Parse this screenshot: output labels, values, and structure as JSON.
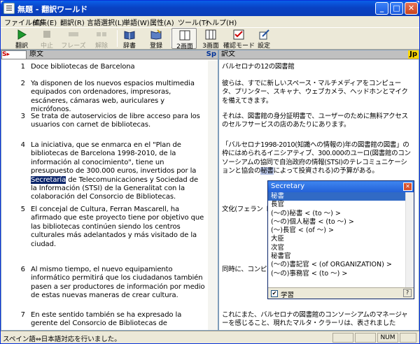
{
  "window": {
    "title": "無題 - 翻訳ワールド",
    "minimize": "_",
    "maximize": "□",
    "close": "✕"
  },
  "menu": [
    "ファイル(F)",
    "編集(E)",
    "翻訳(R)",
    "言語選択(L)",
    "単語(W)",
    "属性(A)",
    "ツール(T)",
    "ヘルプ(H)"
  ],
  "toolbar": [
    {
      "label": "翻訳",
      "icon": "play-icon",
      "enabled": true
    },
    {
      "label": "中止",
      "icon": "stop-icon",
      "enabled": false
    },
    {
      "label": "フレーズ",
      "icon": "phrase-icon",
      "enabled": false
    },
    {
      "label": "解除",
      "icon": "unlink-icon",
      "enabled": false
    },
    {
      "label": "辞書",
      "icon": "dictionary-icon",
      "enabled": true
    },
    {
      "label": "登録",
      "icon": "register-icon",
      "enabled": true
    },
    {
      "label": "2画面",
      "icon": "two-pane-icon",
      "enabled": true,
      "pressed": true
    },
    {
      "label": "3画面",
      "icon": "three-pane-icon",
      "enabled": true
    },
    {
      "label": "確認モード",
      "icon": "confirm-mode-icon",
      "enabled": true
    },
    {
      "label": "設定",
      "icon": "settings-icon",
      "enabled": true
    }
  ],
  "source_pane": {
    "header": "原文",
    "lang_badge": "Sp",
    "lang_selector": "S▸"
  },
  "target_pane": {
    "header": "訳文",
    "lang_badge": "Jp"
  },
  "rows": [
    {
      "num": "1",
      "src": "Doce bibliotecas de Barcelona",
      "tgt": "バルセロナの12の図書館"
    },
    {
      "num": "2",
      "src": "Ya disponen de los nuevos espacios multimedia equipados con ordenadores, impresoras, escáneres, cámaras web, auriculares y micrófonos.",
      "tgt": "彼らは、すでに新しいスペース・マルチメディアをコンピュータ、プリンター、スキャナ、ウェブカメラ、ヘッドホンとマイクを備えてきます。"
    },
    {
      "num": "3",
      "src": "Se trata de autoservicios de libre acceso para los usuarios con carnet de bibliotecas.",
      "tgt": "それは、図書館の身分証明書で、ユーザーのために無料アクセスのセルフサービスの店のあたりにあります。"
    },
    {
      "num": "4",
      "src_a": "La iniciativa, que se enmarca en el \"Plan de bibliotecas de Barcelona 1998-2010, de la información al conocimiento\", tiene un presupuesto de 300.000 euros, invertidos por la ",
      "src_hl": "Secretaría",
      "src_b": " de Telecomunicaciones y Sociedad de la Información (STSI) de la Generalitat con la colaboración del Consorcio de Bibliotecas.",
      "tgt_a": "「バルセロナ1998-2010(知識への情報の)年の図書館の図書」の枠にはめられるイニシアティブ、300.000のユーロ(図書館のコンソーシアムの協同で自治政府の情報(STSI)のテレコミュニケーションと協会の",
      "tgt_hl": "秘書",
      "tgt_b": "によって投資される)の予算がある。"
    },
    {
      "num": "5",
      "src": "El concejal de Cultura, Ferran Mascarell, ha afirmado que este proyecto tiene por objetivo que las bibliotecas continúen siendo los centros culturales más adelantados y más visitado de la ciudad.",
      "tgt": "文化(フェラン トが図書館が ンターであり続"
    },
    {
      "num": "6",
      "src": "Al mismo tiempo, el nuevo equipamiento informático permitirá que los ciudadanos también pasen a ser productores de información por medio de estas nuevas maneras de crear cultura.",
      "tgt": "同時に、コンピ を引き起こすこ ることができま"
    },
    {
      "num": "7",
      "src": "En este sentido también se ha expresado la gerente del Consorcio de Bibliotecas de",
      "tgt": "これにまた、バルセロナの図書館のコンソーシアムのマネージャーを感じること、現れたマルタ・クラーリは、表されました"
    }
  ],
  "popup": {
    "title": "Secretary",
    "items": [
      "秘書",
      "長官",
      "(〜の)秘書 < (to 〜) >",
      "(〜の)個人秘書 < (to 〜) >",
      "(〜)長官 < (of 〜) >",
      "大臣",
      "次官",
      "秘書官",
      "(〜の)書記官 < (of ORGANIZATION) >",
      "(〜の)事務官 < (to 〜) >"
    ],
    "learn_label": "学習",
    "learn_checked": true,
    "help": "?"
  },
  "status": {
    "text": "スペイン語⇔日本語対応を行いました。",
    "num": "NUM"
  }
}
